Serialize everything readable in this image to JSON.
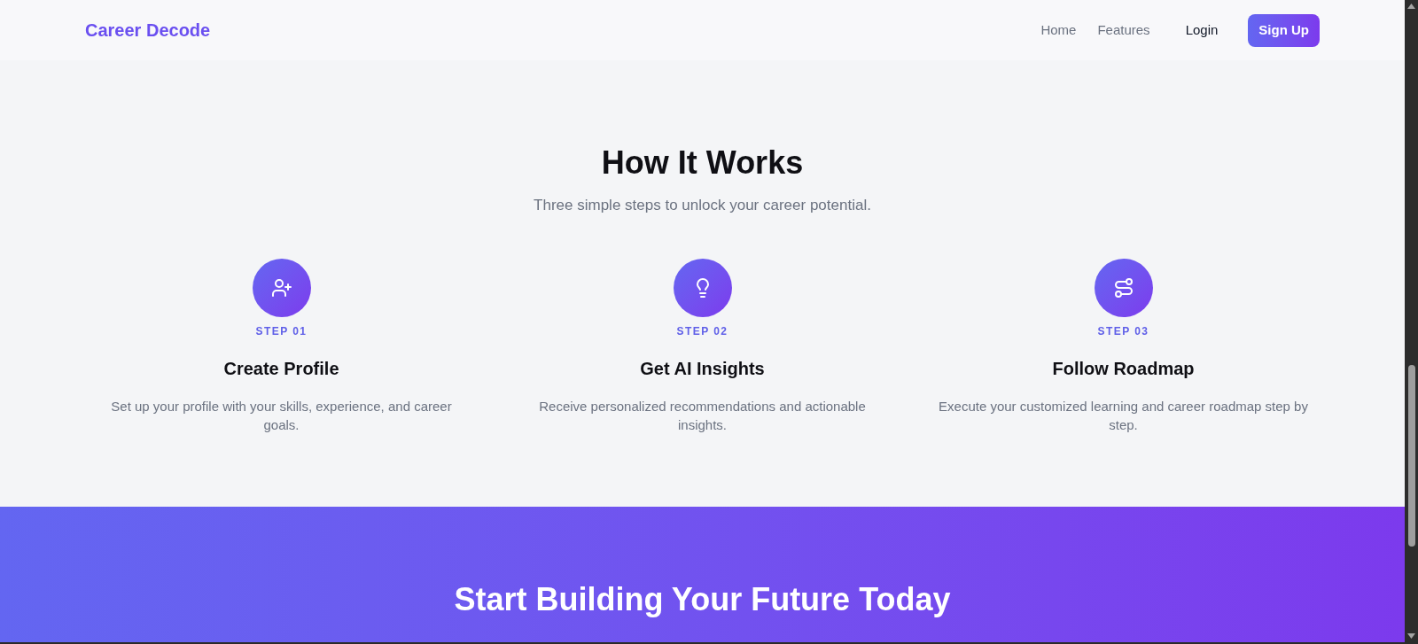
{
  "header": {
    "logo": "Career Decode",
    "nav_links": [
      "Home",
      "Features"
    ],
    "login": "Login",
    "signup": "Sign Up"
  },
  "how_it_works": {
    "title": "How It Works",
    "subtitle": "Three simple steps to unlock your career potential.",
    "steps": [
      {
        "step_label": "STEP 01",
        "title": "Create Profile",
        "description": "Set up your profile with your skills, experience, and career goals."
      },
      {
        "step_label": "STEP 02",
        "title": "Get AI Insights",
        "description": "Receive personalized recommendations and actionable insights."
      },
      {
        "step_label": "STEP 03",
        "title": "Follow Roadmap",
        "description": "Execute your customized learning and career roadmap step by step."
      }
    ]
  },
  "cta": {
    "title": "Start Building Your Future Today"
  }
}
